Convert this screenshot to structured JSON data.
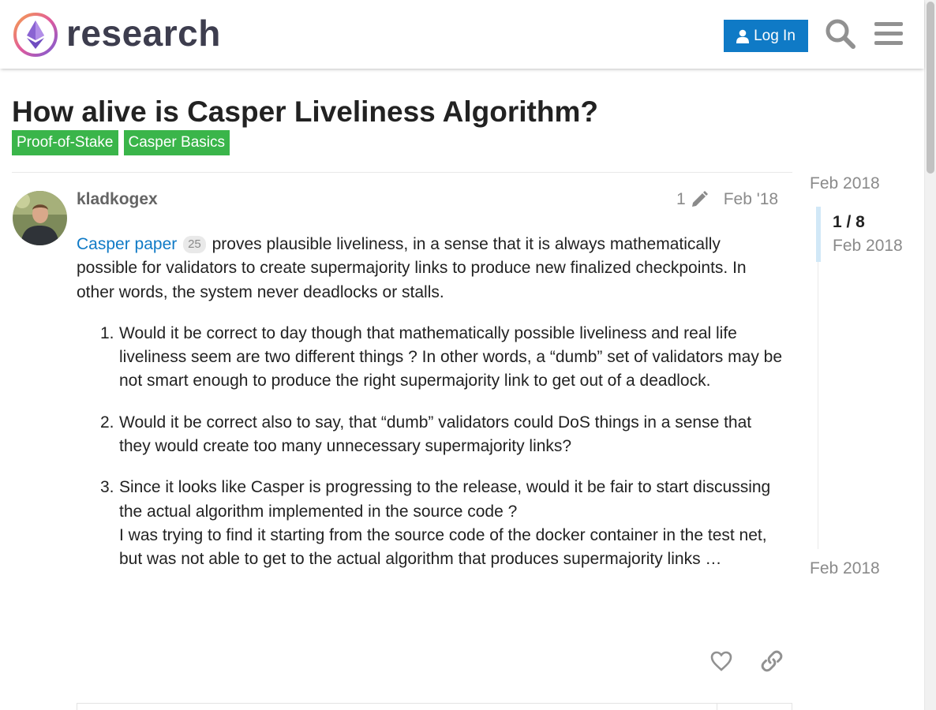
{
  "header": {
    "brand": "research",
    "login_label": "Log In",
    "icons": [
      "ethresear-logo",
      "user-icon",
      "search-icon",
      "hamburger-menu-icon"
    ],
    "accent_color": "#0f7ac6"
  },
  "topic": {
    "title": "How alive is Casper Liveliness Algorithm?",
    "tags": [
      "Proof-of-Stake",
      "Casper Basics"
    ],
    "tag_color": "#3ab54a"
  },
  "post": {
    "username": "kladkogex",
    "edit_count": "1",
    "date": "Feb '18",
    "link_text": "Casper paper",
    "link_clicks": "25",
    "intro_rest": "proves plausible liveliness, in a sense that it is always mathematically possible for validators to create supermajority links to produce new finalized checkpoints. In other words, the system never deadlocks or stalls.",
    "items": [
      {
        "num": "1.",
        "text": "Would it be correct to day though that mathematically possible liveliness and real life liveliness seem are two different things ? In other words, a “dumb” set of validators may be not smart enough to produce the right supermajority link to get out of a deadlock."
      },
      {
        "num": "2.",
        "text": "Would it be correct also to say, that “dumb” validators could DoS things in a sense that they would create too many unnecessary supermajority links?"
      },
      {
        "num": "3.",
        "text": "Since it looks like Casper is progressing to the release, would it be fair to start discussing the actual algorithm implemented in the source code ?",
        "text2": "I was trying to find it starting from the source code of the docker container in the test net, but was not able to get to the actual algorithm that produces supermajority links …"
      }
    ]
  },
  "timeline": {
    "start": "Feb 2018",
    "position": "1 / 8",
    "current_date": "Feb 2018",
    "end": "Feb 2018"
  }
}
